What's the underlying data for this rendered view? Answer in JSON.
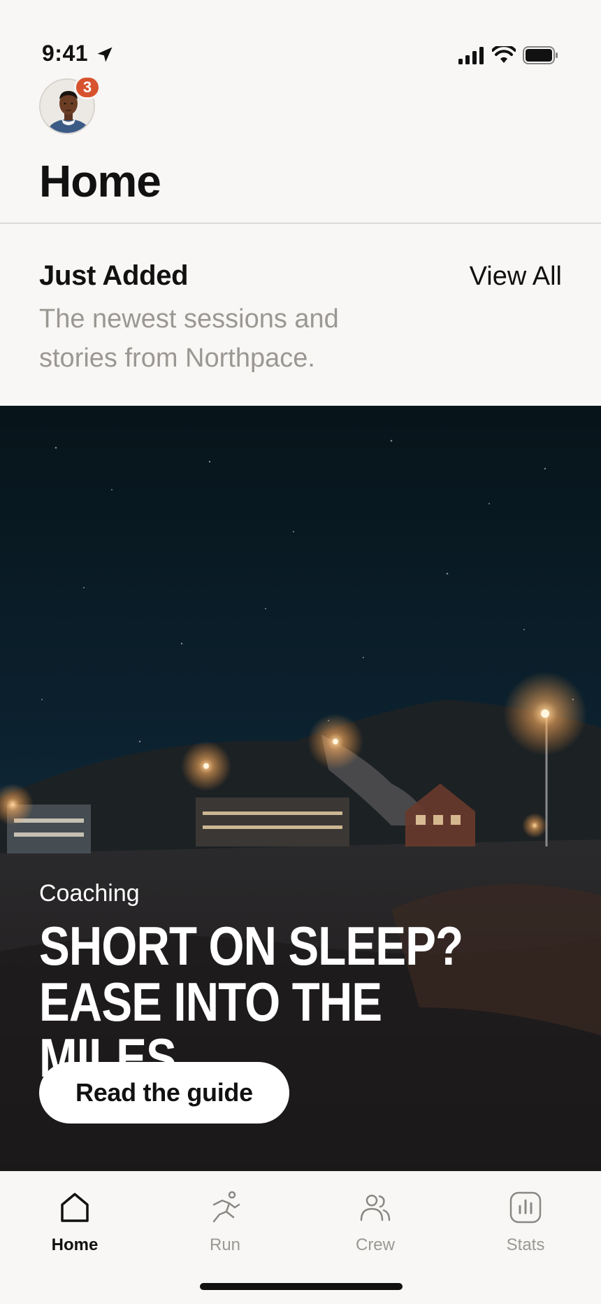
{
  "status_bar": {
    "time": "9:41",
    "icons": [
      "location-arrow-icon",
      "cellular-signal-icon",
      "wifi-icon",
      "battery-icon"
    ]
  },
  "header": {
    "notification_count": "3",
    "title": "Home"
  },
  "section": {
    "title": "Just Added",
    "subtitle": "The newest sessions and stories from Northpace.",
    "view_all_label": "View All"
  },
  "hero": {
    "eyebrow": "Coaching",
    "title_line1": "SHORT ON SLEEP?",
    "title_line2": "EASE INTO THE MILES",
    "cta_label": "Read the guide"
  },
  "tab_bar": {
    "tabs": [
      {
        "label": "Home",
        "icon": "home-icon",
        "active": true
      },
      {
        "label": "Run",
        "icon": "run-icon",
        "active": false
      },
      {
        "label": "Crew",
        "icon": "crew-icon",
        "active": false
      },
      {
        "label": "Stats",
        "icon": "stats-icon",
        "active": false
      }
    ]
  },
  "colors": {
    "background": "#f8f7f5",
    "badge": "#d6532d",
    "text_primary": "#111111",
    "text_secondary": "#9b9894"
  }
}
